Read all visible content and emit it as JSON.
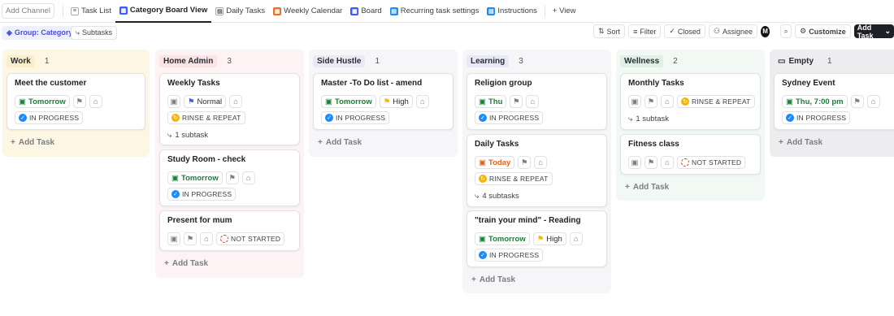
{
  "topbar": {
    "add_channel": "Add Channel",
    "tabs": [
      {
        "label": "Task List",
        "icon": "list-icon"
      },
      {
        "label": "Category Board View",
        "icon": "board-icon"
      },
      {
        "label": "Daily Tasks",
        "icon": "doc-icon"
      },
      {
        "label": "Weekly Calendar",
        "icon": "calendar-icon"
      },
      {
        "label": "Board",
        "icon": "board-icon"
      },
      {
        "label": "Recurring task settings",
        "icon": "doc-icon"
      },
      {
        "label": "Instructions",
        "icon": "doc-icon"
      }
    ],
    "view": "+ View"
  },
  "toolbar": {
    "group": "Group: Category",
    "subtasks": "Subtasks",
    "sort": "Sort",
    "filter": "Filter",
    "closed": "Closed",
    "assignee": "Assignee",
    "avatar": "M",
    "customize": "Customize",
    "add_task": "Add Task"
  },
  "colors": {
    "in_progress": "#1a8cff",
    "rinse": "#f4b400",
    "not_started": "#d2302c",
    "green": "#1a7f37"
  },
  "columns": [
    {
      "name": "Work",
      "count": "1",
      "color": "#fdf6e3",
      "tag": "#fbeeca",
      "cards": [
        {
          "title": "Meet the customer",
          "date": "Tomorrow",
          "status": "IN PROGRESS"
        }
      ],
      "add": "Add Task"
    },
    {
      "name": "Home Admin",
      "count": "3",
      "color": "#fdf3f4",
      "tag": "#fbe3e6",
      "cards": [
        {
          "title": "Weekly Tasks",
          "priority": "Normal",
          "status": "RINSE & REPEAT",
          "subtasks": "1 subtask"
        },
        {
          "title": "Study Room - check",
          "date": "Tomorrow",
          "status": "IN PROGRESS"
        },
        {
          "title": "Present for mum",
          "status": "NOT STARTED"
        }
      ],
      "add": "Add Task"
    },
    {
      "name": "Side Hustle",
      "count": "1",
      "color": "#f6f6f8",
      "tag": "#ece9f6",
      "cards": [
        {
          "title": "Master -To Do list - amend",
          "date": "Tomorrow",
          "priority": "High",
          "status": "IN PROGRESS"
        }
      ],
      "add": "Add Task"
    },
    {
      "name": "Learning",
      "count": "3",
      "color": "#f6f6f8",
      "tag": "#e9e8f8",
      "cards": [
        {
          "title": "Religion group",
          "date": "Thu",
          "status": "IN PROGRESS"
        },
        {
          "title": "Daily Tasks",
          "date": "Today",
          "status": "RINSE & REPEAT",
          "subtasks": "4 subtasks"
        },
        {
          "title": "\"train your mind\" - Reading",
          "date": "Tomorrow",
          "priority": "High",
          "status": "IN PROGRESS"
        }
      ],
      "add": "Add Task"
    },
    {
      "name": "Wellness",
      "count": "2",
      "color": "#f2f8f4",
      "tag": "#dff1e6",
      "cards": [
        {
          "title": "Monthly Tasks",
          "status": "RINSE & REPEAT",
          "subtasks": "1 subtask"
        },
        {
          "title": "Fitness class",
          "status": "NOT STARTED"
        }
      ],
      "add": "Add Task"
    },
    {
      "name": "Empty",
      "count": "1",
      "color": "#ededef",
      "tag": "#ededef",
      "cards": [
        {
          "title": "Sydney Event",
          "date": "Thu, 7:00 pm",
          "status": "IN PROGRESS"
        }
      ],
      "add": "Add Task"
    }
  ]
}
